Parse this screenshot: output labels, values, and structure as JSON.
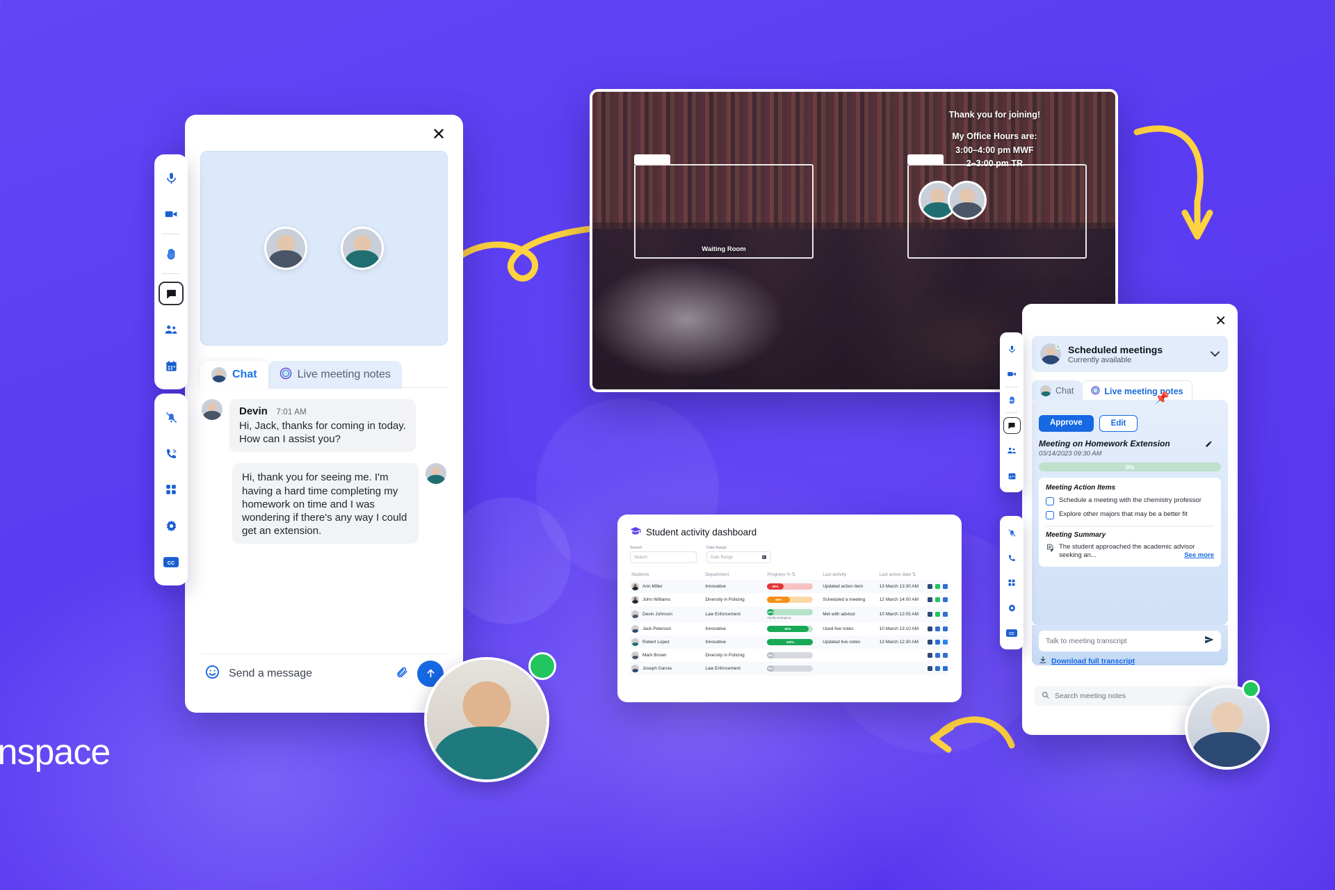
{
  "brand": {
    "name": "inspace",
    "accent": "#5b3ff0",
    "blue": "#1668e3",
    "green": "#22c55e"
  },
  "chat_window": {
    "close_label": "✕",
    "tabs": [
      {
        "label": "Chat",
        "icon": "avatar-icon",
        "active": true
      },
      {
        "label": "Live meeting notes",
        "icon": "live-notes-icon",
        "active": false
      }
    ],
    "messages": [
      {
        "author": "Devin",
        "time": "7:01 AM",
        "text": "Hi, Jack, thanks for coming in today. How can I assist you?",
        "own": false
      },
      {
        "author": "",
        "time": "",
        "text": "Hi, thank you for seeing me. I'm having a hard time completing my homework on time and I was wondering if there's any way I could get an extension.",
        "own": true
      }
    ],
    "composer": {
      "placeholder": "Send a message",
      "emoji_icon": "smiley-icon",
      "attach_icon": "paperclip-icon",
      "send_icon": "arrow-up-icon"
    }
  },
  "left_toolbar": {
    "group_one": [
      {
        "name": "microphone-icon",
        "label": "Microphone"
      },
      {
        "name": "video-camera-icon",
        "label": "Camera"
      },
      {
        "name": "divider",
        "label": ""
      },
      {
        "name": "raise-hand-icon",
        "label": "Raise hand"
      },
      {
        "name": "divider",
        "label": ""
      },
      {
        "name": "chat-icon",
        "label": "Chat",
        "selected": true
      },
      {
        "name": "people-icon",
        "label": "Participants"
      },
      {
        "name": "calendar-icon",
        "label": "Calendar"
      }
    ],
    "group_two": [
      {
        "name": "bell-off-icon",
        "label": "Notifications off"
      },
      {
        "name": "phone-ring-icon",
        "label": "Call"
      },
      {
        "name": "grid-icon",
        "label": "Layout"
      },
      {
        "name": "settings-gear-icon",
        "label": "Settings"
      },
      {
        "name": "closed-captions-icon",
        "label": "CC"
      }
    ]
  },
  "video_conference": {
    "overlay_note": {
      "line1": "Thank you for joining!",
      "line2": "My Office Hours are:",
      "line3": "3:00–4:00 pm MWF",
      "line4": "2–3:00 pm TR"
    },
    "tiles": [
      {
        "caption": "Waiting Room",
        "participants": 0
      },
      {
        "caption": "",
        "participants": 2
      }
    ]
  },
  "notes_panel": {
    "close_label": "✕",
    "scheduled": {
      "title": "Scheduled meetings",
      "subtitle": "Currently available",
      "chevron": "⌄",
      "status": "online"
    },
    "tabs": [
      {
        "label": "Chat",
        "active": false
      },
      {
        "label": "Live meeting notes",
        "active": true
      }
    ],
    "actions": {
      "approve": "Approve",
      "edit": "Edit"
    },
    "meeting": {
      "title": "Meeting on Homework Extension",
      "date": "03/14/2023 09:30 AM",
      "progress_label": "0%",
      "progress_value": 0
    },
    "action_items": {
      "heading": "Meeting Action Items",
      "items": [
        {
          "text": "Schedule a meeting with the chemistry professor",
          "checked": false
        },
        {
          "text": "Explore other majors that may be a better fit",
          "checked": false
        }
      ]
    },
    "summary": {
      "heading": "Meeting Summary",
      "text": "The student approached the academic advisor seeking an...",
      "see_more": "See more"
    },
    "transcript_input": {
      "placeholder": "Talk to meeting transcript",
      "send_icon": "send-icon"
    },
    "download_link": "Download full transcript",
    "search": {
      "placeholder": "Search meeting notes",
      "icon": "search-icon"
    }
  },
  "dashboard": {
    "title": "Student activity dashboard",
    "title_icon": "graduation-cap-icon",
    "filters": [
      {
        "label": "Search",
        "placeholder": "Search"
      },
      {
        "label": "Date Range",
        "placeholder": "Date Range",
        "icon": "calendar-icon"
      }
    ],
    "columns": [
      "Students",
      "Department",
      "Progress %",
      "Last activity",
      "Last active date"
    ],
    "sortable": [
      false,
      false,
      true,
      false,
      true
    ],
    "rows": [
      {
        "student": "Ann Miller",
        "department": "Innovative",
        "progress": 35,
        "progress_label": "35%",
        "progress_color": "#e2363a",
        "track_color": "#f7c2c4",
        "note": "",
        "last_activity": "Updated action item",
        "last_active_date": "13 March 13:30 AM",
        "avatar": "dark"
      },
      {
        "student": "John Williams",
        "department": "Diversity in Policing",
        "progress": 50,
        "progress_label": "50%",
        "progress_color": "#f59016",
        "track_color": "#fbd9a7",
        "note": "",
        "last_activity": "Scheduled a meeting",
        "last_active_date": "12 March 14:00 AM",
        "avatar": "dark"
      },
      {
        "student": "Devin Johnson",
        "department": "Law Enforcement",
        "progress": 10,
        "progress_label": "10%",
        "progress_color": "#19a85c",
        "track_color": "#b6e3c8",
        "note": "Family emergency",
        "last_activity": "Met with advisor",
        "last_active_date": "10 March 12:05 AM",
        "avatar": "grey"
      },
      {
        "student": "Jack Peterson",
        "department": "Innovative",
        "progress": 90,
        "progress_label": "90%",
        "progress_color": "#18a957",
        "track_color": "#bfe5cd",
        "note": "",
        "last_activity": "Used live notes",
        "last_active_date": "10 March 13:10 AM",
        "avatar": "suit"
      },
      {
        "student": "Robert Lopez",
        "department": "Innovative",
        "progress": 100,
        "progress_label": "100%",
        "progress_color": "#18a957",
        "track_color": "#18a957",
        "note": "",
        "last_activity": "Updated live notes",
        "last_active_date": "13 March 12:30 AM",
        "avatar": "teal"
      },
      {
        "student": "Mark Brown",
        "department": "Diversity in Policing",
        "progress": 0,
        "progress_label": "0%",
        "progress_color": "#b7bcc5",
        "track_color": "#d5d9df",
        "note": "",
        "last_activity": "",
        "last_active_date": "",
        "avatar": "grey"
      },
      {
        "student": "Joseph Garcia",
        "department": "Law Enforcement",
        "progress": 0,
        "progress_label": "0%",
        "progress_color": "#b7bcc5",
        "track_color": "#d5d9df",
        "note": "",
        "last_activity": "",
        "last_active_date": "",
        "avatar": "suit"
      }
    ]
  }
}
